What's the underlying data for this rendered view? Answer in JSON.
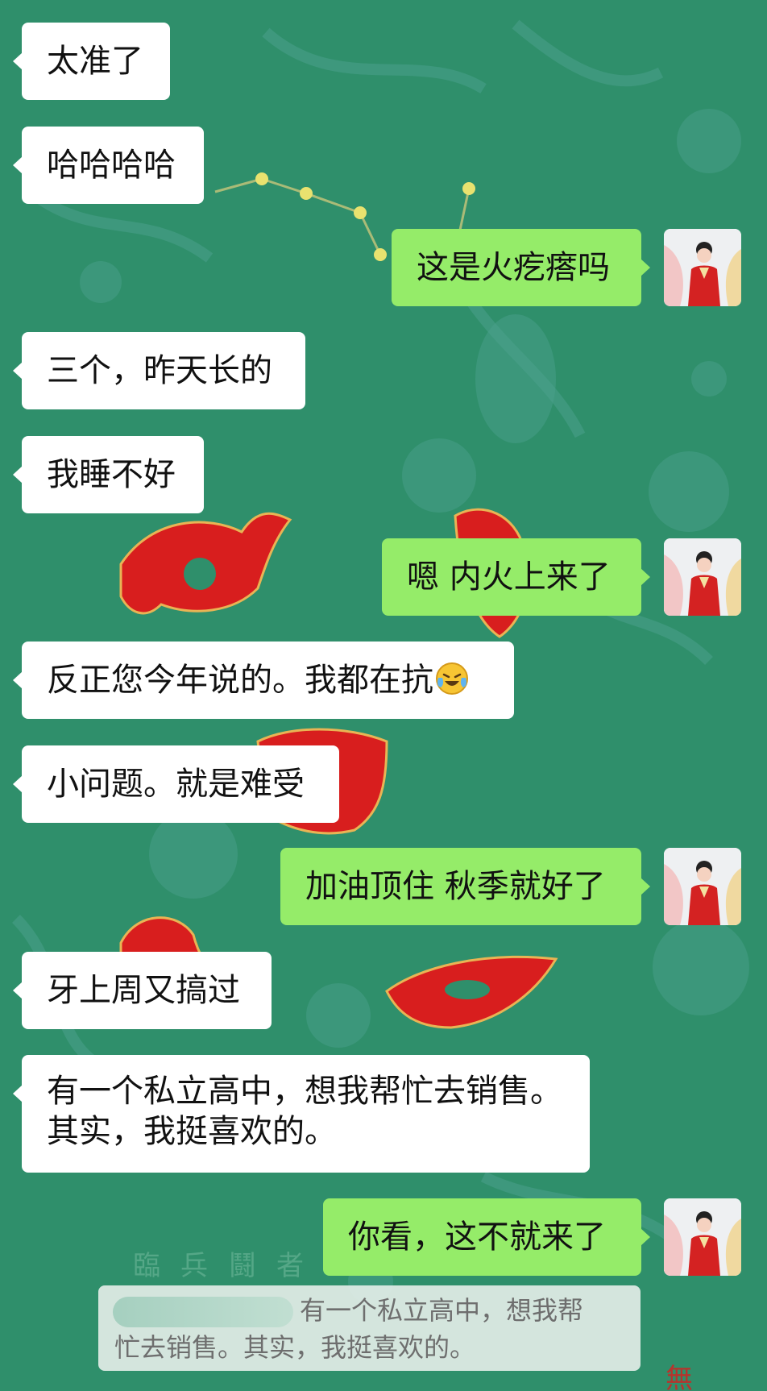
{
  "background": {
    "base_color": "#2f8f6b",
    "motif_color": "#4aa08c",
    "red_character_color": "#d81e1e",
    "stars": "gold-constellation",
    "bottom_text": "臨 兵 鬪 者"
  },
  "bubble_colors": {
    "received": "#ffffff",
    "sent": "#95ec69"
  },
  "messages": [
    {
      "side": "left",
      "text": "太准了"
    },
    {
      "side": "left",
      "text": "哈哈哈哈"
    },
    {
      "side": "right",
      "text": "这是火疙瘩吗"
    },
    {
      "side": "left",
      "text": "三个，昨天长的"
    },
    {
      "side": "left",
      "text": "我睡不好"
    },
    {
      "side": "right",
      "text": "嗯 内火上来了"
    },
    {
      "side": "left",
      "text": "反正您今年说的。我都在抗",
      "emoji": "crying-laughing-face-icon"
    },
    {
      "side": "left",
      "text": "小问题。就是难受"
    },
    {
      "side": "right",
      "text": "加油顶住 秋季就好了"
    },
    {
      "side": "left",
      "text": "牙上周又搞过"
    },
    {
      "side": "left",
      "lines": [
        "有一个私立高中，想我帮忙去销售。",
        "其实，我挺喜欢的。"
      ]
    },
    {
      "side": "right",
      "text": "你看，这不就来了"
    }
  ],
  "quote": {
    "line1": "有一个私立高中，想我帮",
    "line2": "忙去销售。其实，我挺喜欢的。"
  }
}
